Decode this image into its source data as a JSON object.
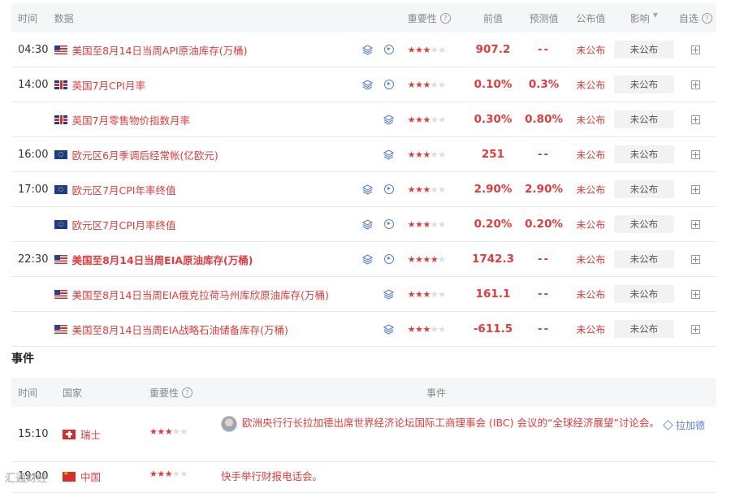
{
  "header": {
    "time": "时间",
    "data": "数据",
    "importance": "重要性",
    "prev": "前值",
    "forecast": "预测值",
    "published": "公布值",
    "effect": "影响",
    "favorite": "自选"
  },
  "rows": [
    {
      "time": "04:30",
      "flag": "us",
      "title": "美国至8月14日当周API原油库存(万桶)",
      "bold": false,
      "icons": [
        "layers-icon",
        "play-icon"
      ],
      "stars": 3,
      "prev": "907.2",
      "forecast": "--",
      "published": "未公布",
      "effect": "未公布"
    },
    {
      "time": "14:00",
      "flag": "uk",
      "title": "英国7月CPI月率",
      "bold": false,
      "icons": [
        "layers-icon",
        "play-icon"
      ],
      "stars": 3,
      "prev": "0.10%",
      "forecast": "0.3%",
      "published": "未公布",
      "effect": "未公布"
    },
    {
      "time": "",
      "flag": "uk",
      "title": "英国7月零售物价指数月率",
      "bold": false,
      "icons": [
        "layers-icon"
      ],
      "stars": 3,
      "prev": "0.30%",
      "forecast": "0.80%",
      "published": "未公布",
      "effect": "未公布"
    },
    {
      "time": "16:00",
      "flag": "eu",
      "title": "欧元区6月季调后经常帐(亿欧元)",
      "bold": false,
      "icons": [
        "layers-icon"
      ],
      "stars": 3,
      "prev": "251",
      "forecast": "--",
      "published": "未公布",
      "effect": "未公布"
    },
    {
      "time": "17:00",
      "flag": "eu",
      "title": "欧元区7月CPI年率终值",
      "bold": false,
      "icons": [
        "layers-icon",
        "play-icon"
      ],
      "stars": 3,
      "prev": "2.90%",
      "forecast": "2.90%",
      "published": "未公布",
      "effect": "未公布"
    },
    {
      "time": "",
      "flag": "eu",
      "title": "欧元区7月CPI月率终值",
      "bold": false,
      "icons": [
        "layers-icon",
        "play-icon"
      ],
      "stars": 3,
      "prev": "0.20%",
      "forecast": "0.20%",
      "published": "未公布",
      "effect": "未公布"
    },
    {
      "time": "22:30",
      "flag": "us",
      "title": "美国至8月14日当周EIA原油库存(万桶)",
      "bold": true,
      "icons": [
        "layers-icon",
        "play-icon"
      ],
      "stars": 4,
      "prev": "1742.3",
      "forecast": "--",
      "published": "未公布",
      "effect": "未公布"
    },
    {
      "time": "",
      "flag": "us",
      "title": "美国至8月14日当周EIA俄克拉荷马州库欣原油库存(万桶)",
      "bold": false,
      "icons": [
        "layers-icon"
      ],
      "stars": 3,
      "prev": "161.1",
      "forecast": "--",
      "published": "未公布",
      "effect": "未公布"
    },
    {
      "time": "",
      "flag": "us",
      "title": "美国至8月14日当周EIA战略石油储备库存(万桶)",
      "bold": false,
      "icons": [
        "layers-icon"
      ],
      "stars": 3,
      "prev": "-611.5",
      "forecast": "--",
      "published": "未公布",
      "effect": "未公布"
    }
  ],
  "events_section": {
    "title": "事件",
    "header": {
      "time": "时间",
      "country": "国家",
      "importance": "重要性",
      "event": "事件"
    },
    "rows": [
      {
        "time": "15:10",
        "flag": "ch",
        "country": "瑞士",
        "stars": 3,
        "text": "欧洲央行行长拉加德出席世界经济论坛国际工商理事会 (IBC) 会议的“全球经济展望”讨论会。",
        "person": "拉加德"
      },
      {
        "time": "19:00",
        "flag": "cn",
        "country": "中国",
        "stars": 3,
        "text": "快手举行财报电话会。",
        "person": ""
      }
    ]
  },
  "watermark": "汇通财经",
  "colors": {
    "accent": "#e03c3c",
    "link": "#5b7fd1",
    "header_bg": "#f5f6f8",
    "badge_bg": "#f2f2f2"
  }
}
